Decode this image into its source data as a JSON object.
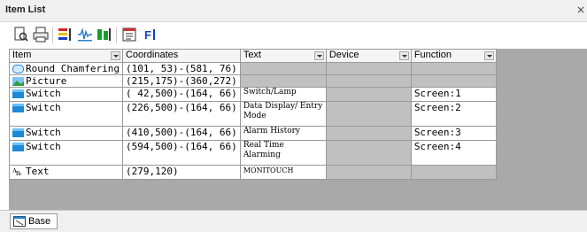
{
  "window": {
    "title": "Item List",
    "close_glyph": "×"
  },
  "toolbar": {
    "buttons": [
      {
        "name": "print-preview-icon"
      },
      {
        "name": "print-icon"
      },
      {
        "name": "color-bars-icon"
      },
      {
        "name": "waveform-icon"
      },
      {
        "name": "green-bars-icon"
      },
      {
        "name": "properties-icon"
      },
      {
        "name": "filter-icon",
        "label": "F"
      }
    ]
  },
  "table": {
    "columns": [
      "Item",
      "Coordinates",
      "Text",
      "Device",
      "Function"
    ],
    "rows": [
      {
        "icon": "round-chamfering-icon",
        "item": "Round Chamfering",
        "coord": "(101, 53)-(581, 76)",
        "text": "",
        "device": "",
        "function": ""
      },
      {
        "icon": "picture-icon",
        "item": "Picture",
        "coord": "(215,175)-(360,272)",
        "text": "",
        "device": "",
        "function": ""
      },
      {
        "icon": "switch-icon",
        "item": "Switch",
        "coord": "( 42,500)-(164, 66)",
        "text": "Switch/Lamp",
        "device": "",
        "function": "Screen:1"
      },
      {
        "icon": "switch-icon",
        "item": "Switch",
        "coord": "(226,500)-(164, 66)",
        "text": "Data Display/ Entry Mode",
        "device": "",
        "function": "Screen:2"
      },
      {
        "icon": "switch-icon",
        "item": "Switch",
        "coord": "(410,500)-(164, 66)",
        "text": "Alarm History",
        "device": "",
        "function": "Screen:3"
      },
      {
        "icon": "switch-icon",
        "item": "Switch",
        "coord": "(594,500)-(164, 66)",
        "text": "Real Time Alarming",
        "device": "",
        "function": "Screen:4"
      },
      {
        "icon": "text-item-icon",
        "item": "Text",
        "coord": "(279,120)",
        "text": "MONITOUCH",
        "device": "",
        "function": ""
      }
    ]
  },
  "tabs": [
    {
      "label": "Base"
    }
  ],
  "colors": {
    "grid_bg": "#a9a9a9",
    "disabled_cell": "#c0c0c0",
    "switch_icon": "#1c8ad6"
  }
}
